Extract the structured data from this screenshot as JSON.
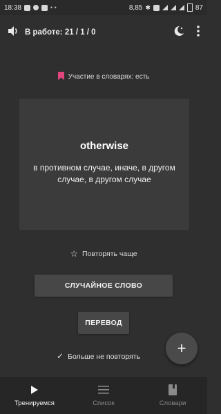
{
  "status_bar": {
    "time": "18:38",
    "speed": "8,85",
    "battery": "87"
  },
  "app_bar": {
    "title": "В работе: 21 / 1 / 0",
    "icons": [
      "volume-icon",
      "night-mode-icon",
      "more-vert-icon"
    ]
  },
  "dictionary_status": "Участие в словарях: есть",
  "card": {
    "word": "otherwise",
    "translation": "в противном случае, иначе, в другом случае, в другом случае"
  },
  "repeat_more_label": "Повторять чаще",
  "random_word_button": "СЛУЧАЙНОЕ СЛОВО",
  "translate_button": "ПЕРЕВОД",
  "no_repeat_label": "Больше не повторять",
  "fab_label": "+",
  "bottom_nav": {
    "items": [
      {
        "label": "Тренируемся",
        "icon": "play-icon",
        "active": true
      },
      {
        "label": "Список",
        "icon": "list-icon",
        "active": false
      },
      {
        "label": "Словари",
        "icon": "book-icon",
        "active": false
      }
    ]
  },
  "colors": {
    "background": "#2f2f2f",
    "card": "#3b3b3b",
    "bookmark": "#e0457b",
    "button": "#474747"
  }
}
